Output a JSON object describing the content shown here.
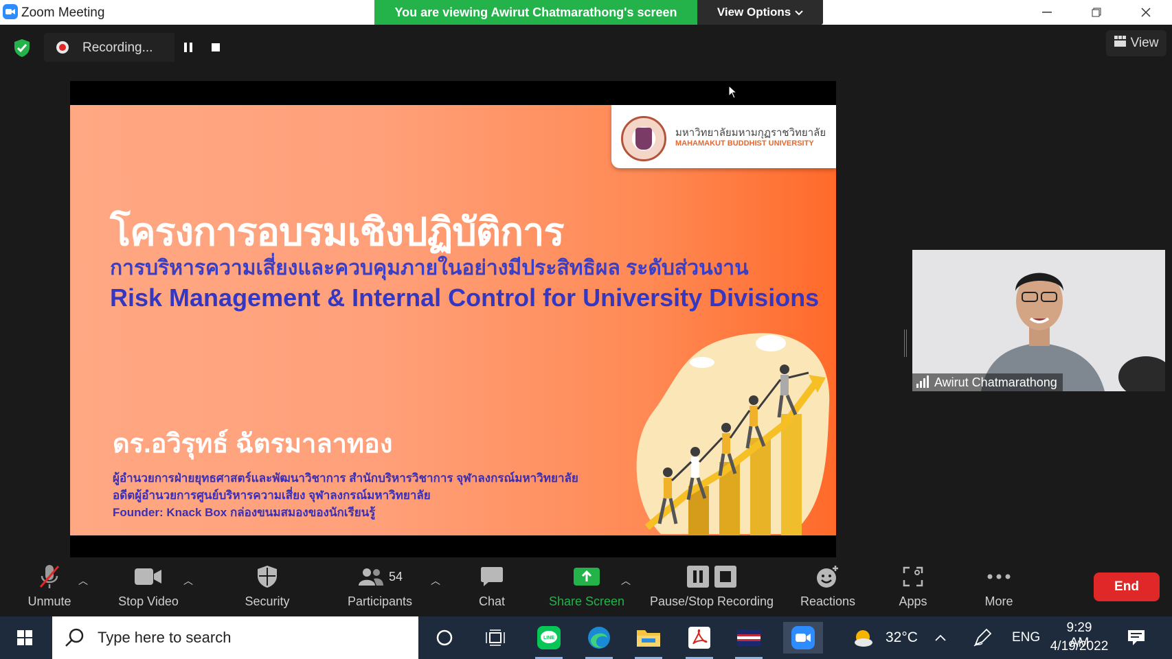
{
  "window": {
    "title": "Zoom Meeting",
    "viewing_banner": "You are viewing Awirut Chatmarathong's screen",
    "view_options_label": "View Options"
  },
  "meeting": {
    "recording_label": "Recording...",
    "view_label": "View"
  },
  "slide": {
    "university_th": "มหาวิทยาลัยมหามกุฏราชวิทยาลัย",
    "university_en": "MAHAMAKUT BUDDHIST UNIVERSITY",
    "title_th": "โครงการอบรมเชิงปฏิบัติการ",
    "subtitle_th": "การบริหารความเสี่ยงและควบคุมภายในอย่างมีประสิทธิผล ระดับส่วนงาน",
    "subtitle_en": "Risk Management & Internal Control for University  Divisions",
    "presenter_name": "ดร.อวิรุทธ์ ฉัตรมาลาทอง",
    "presenter_roles": [
      "ผู้อำนวยการฝ่ายยุทธศาสตร์และพัฒนาวิชาการ สำนักบริหารวิชาการ จุฬาลงกรณ์มหาวิทยาลัย",
      "อดีตผู้อำนวยการศูนย์บริหารความเสี่ยง จุฬาลงกรณ์มหาวิทยาลัย",
      "Founder: Knack Box กล่องขนมสมองของนักเรียนรู้"
    ]
  },
  "participant": {
    "name": "Awirut Chatmarathong"
  },
  "toolbar": {
    "unmute": "Unmute",
    "stop_video": "Stop Video",
    "security": "Security",
    "participants": "Participants",
    "participants_count": "54",
    "chat": "Chat",
    "share_screen": "Share Screen",
    "pause_stop_recording": "Pause/Stop Recording",
    "reactions": "Reactions",
    "apps": "Apps",
    "more": "More",
    "end": "End",
    "share_color": "#24b34b",
    "end_color": "#e02828"
  },
  "taskbar": {
    "search_placeholder": "Type here to search",
    "temperature": "32°C",
    "language": "ENG",
    "time": "9:29 AM",
    "date": "4/19/2022"
  }
}
